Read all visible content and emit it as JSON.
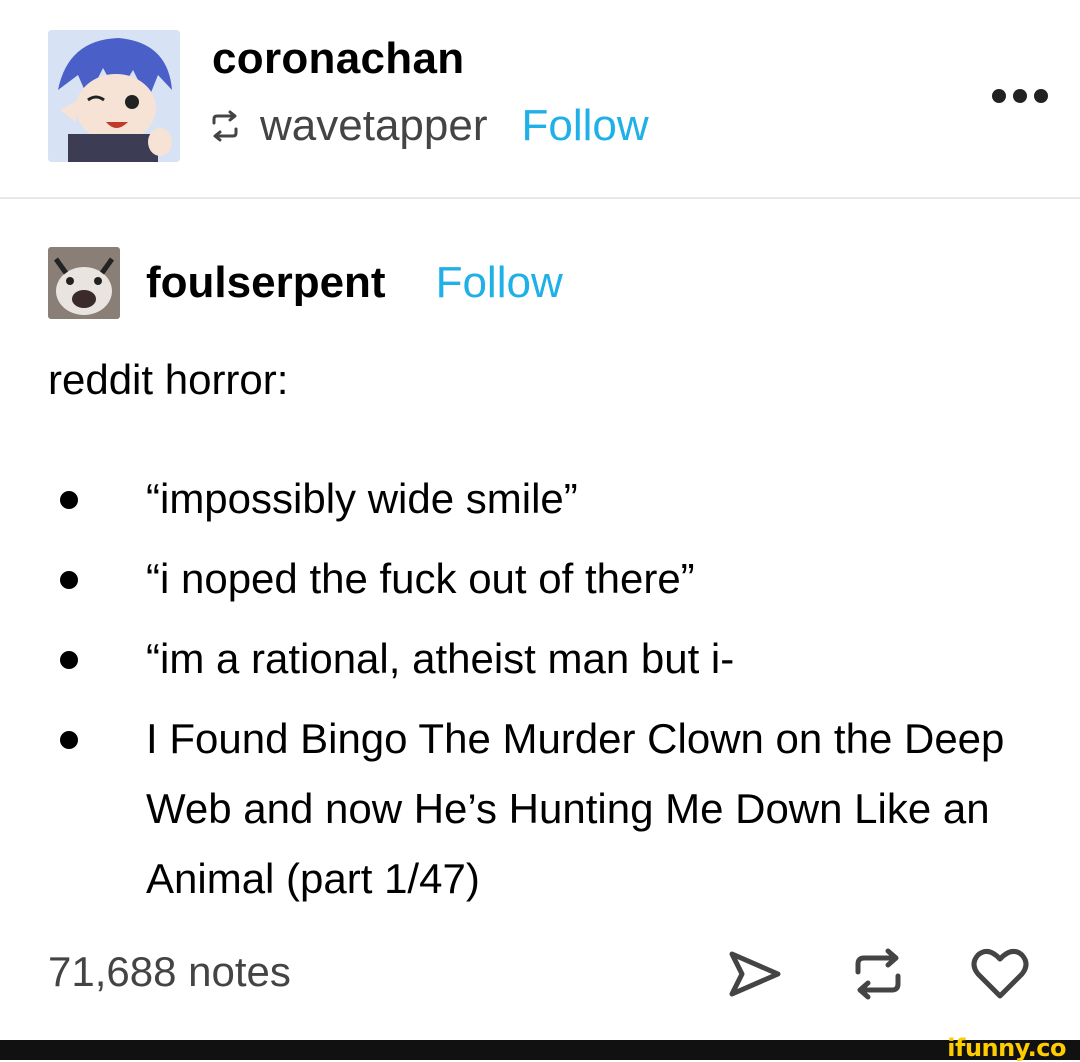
{
  "reblog_header": {
    "reblogger_name": "coronachan",
    "reblogged_from": "wavetapper",
    "follow_label": "Follow",
    "more_icon": "more-horizontal-icon",
    "reblog_icon": "reblog-icon"
  },
  "post": {
    "author_name": "foulserpent",
    "follow_label": "Follow",
    "heading": "reddit horror:",
    "bullets": [
      "“impossibly wide smile”",
      "“i noped the fuck out of there”",
      "“im a rational, atheist man but i-",
      "I Found Bingo The Murder Clown on the Deep Web and now He’s Hunting Me Down Like an Animal (part 1/47)"
    ]
  },
  "footer": {
    "notes": "71,688 notes",
    "actions": [
      "share-icon",
      "reblog-icon",
      "heart-icon"
    ]
  },
  "watermark": "ifunny.co",
  "colors": {
    "follow": "#1eb0e6",
    "text": "#000000",
    "secondary": "#444444",
    "watermark": "#ffcc00"
  }
}
